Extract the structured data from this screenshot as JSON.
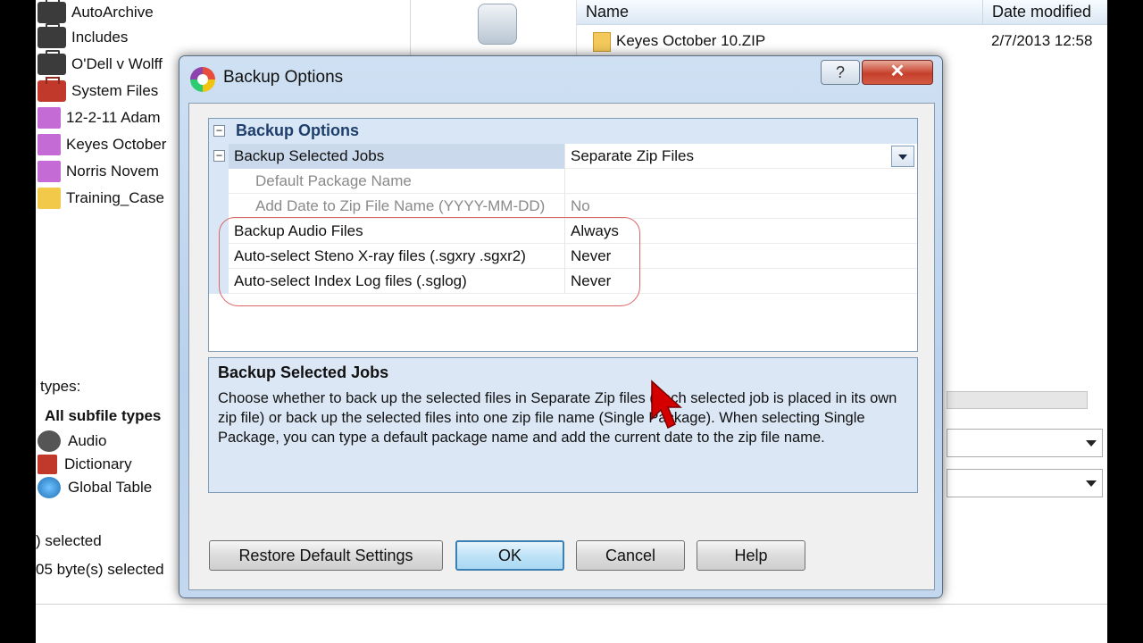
{
  "background": {
    "tree_items": [
      {
        "label": "AutoArchive",
        "icon": "briefcase-icon"
      },
      {
        "label": "Includes",
        "icon": "briefcase-icon"
      },
      {
        "label": "O'Dell v Wolff",
        "icon": "briefcase-icon"
      },
      {
        "label": "System Files",
        "icon": "red-briefcase-icon"
      },
      {
        "label": "12-2-11 Adam",
        "icon": "purple-folder-icon"
      },
      {
        "label": "Keyes October",
        "icon": "purple-folder-icon"
      },
      {
        "label": "Norris Novem",
        "icon": "purple-folder-icon"
      },
      {
        "label": "Training_Case",
        "icon": "yellow-folder-icon"
      }
    ],
    "file_list": {
      "columns": [
        "Name",
        "Date modified"
      ],
      "rows": [
        {
          "name": "Keyes October 10.ZIP",
          "date": "2/7/2013 12:58"
        }
      ]
    },
    "subfile_types_label": "types:",
    "subfile_types": [
      {
        "label": "All subfile types"
      },
      {
        "label": "Audio",
        "icon": "headphones-icon"
      },
      {
        "label": "Dictionary",
        "icon": "book-icon"
      },
      {
        "label": "Global Table",
        "icon": "globe-icon"
      }
    ],
    "status": {
      "selected": ") selected",
      "bytes": "05 byte(s) selected"
    }
  },
  "dialog": {
    "title": "Backup Options",
    "help_glyph": "?",
    "close_glyph": "✕",
    "grid": {
      "category": "Backup Options",
      "rows": [
        {
          "label": "Backup Selected Jobs",
          "value": "Separate Zip Files"
        },
        {
          "label": "Default Package Name",
          "value": ""
        },
        {
          "label": "Add Date to Zip File Name (YYYY-MM-DD)",
          "value": "No"
        },
        {
          "label": "Backup Audio Files",
          "value": "Always"
        },
        {
          "label": "Auto-select Steno X-ray files (.sgxry .sgxr2)",
          "value": "Never"
        },
        {
          "label": "Auto-select Index Log files (.sglog)",
          "value": "Never"
        }
      ]
    },
    "description": {
      "title": "Backup Selected Jobs",
      "text": "Choose whether to back up the selected files in Separate Zip files (each selected job is placed in its own zip file) or back up the selected files into one zip file name (Single Package). When selecting Single Package, you can type a default package name and add the current date to the zip file name."
    },
    "buttons": {
      "restore": "Restore Default Settings",
      "ok": "OK",
      "cancel": "Cancel",
      "help": "Help"
    }
  },
  "colors": {
    "accent": "#3c7fb1",
    "category_text": "#1e3f6b",
    "highlight": "#dd6666",
    "close": "#c6402b"
  }
}
